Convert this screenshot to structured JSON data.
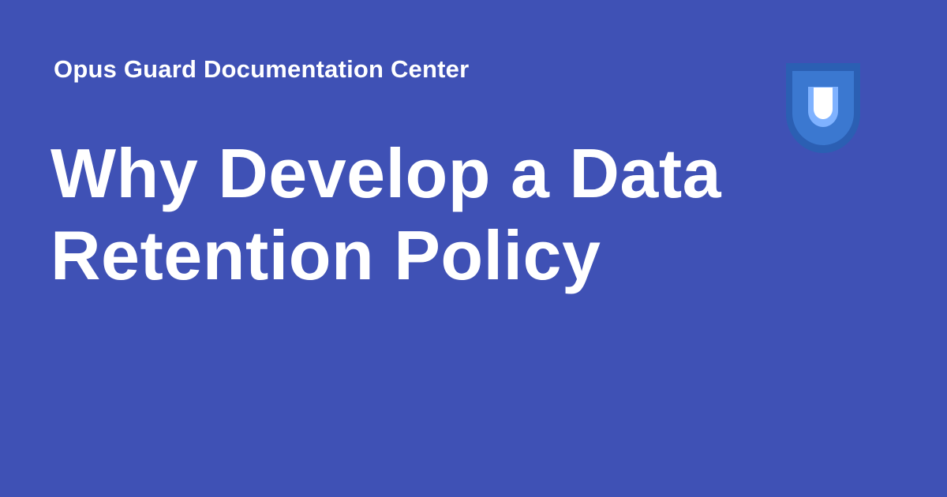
{
  "site": {
    "name": "Opus Guard Documentation Center"
  },
  "page": {
    "title": "Why Develop a Data Retention Policy"
  },
  "logo": {
    "icon": "shield-icon"
  },
  "colors": {
    "background": "#3f51b5",
    "text": "#ffffff",
    "shield_outer": "#2b5fb3",
    "shield_mid": "#3b78d0",
    "shield_inner": "#7fb2ff"
  }
}
